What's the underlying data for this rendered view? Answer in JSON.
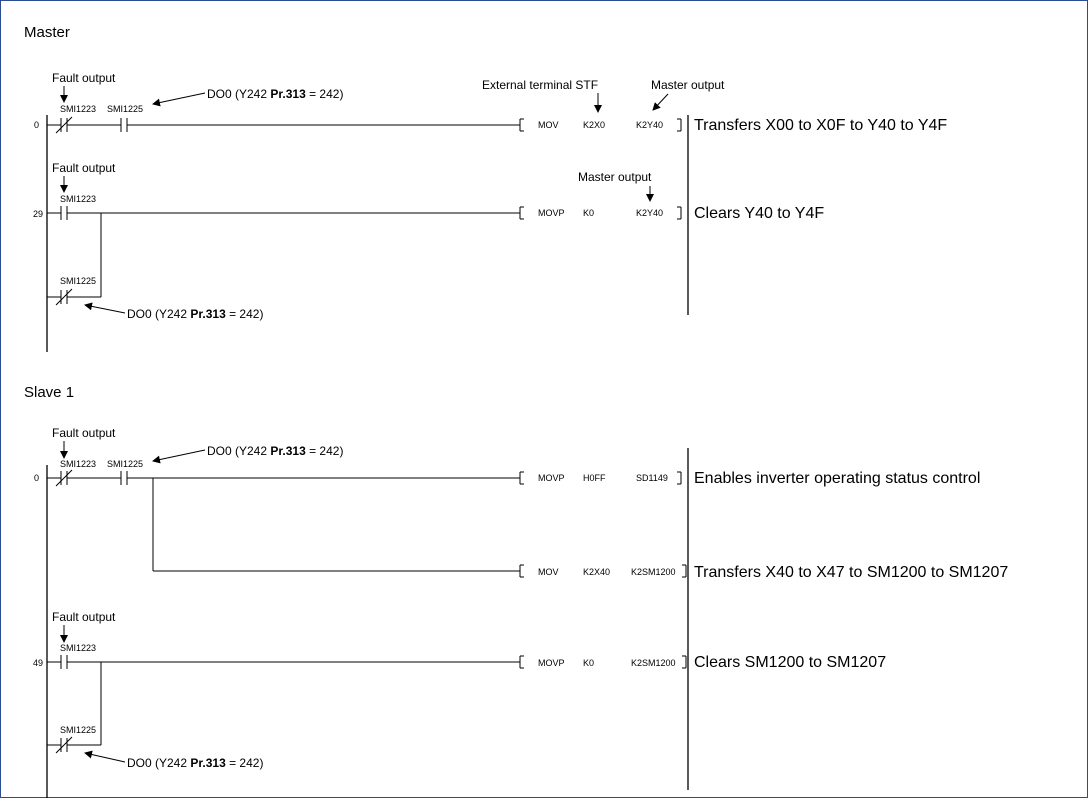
{
  "annotations": {
    "fault_output": "Fault output",
    "do0_prefix": "DO0 (Y242 ",
    "do0_pr": "Pr.313",
    "do0_suffix": " = 242)",
    "external_terminal_stf": "External terminal STF",
    "master_output": "Master output"
  },
  "sections": [
    {
      "title": "Master",
      "rungs": [
        {
          "step": "0",
          "contacts": [
            "SMI1223",
            "SMI1225"
          ],
          "instruction": "MOV",
          "source": "K2X0",
          "destination": "K2Y40",
          "comment": "Transfers X00 to X0F to Y40 to Y4F"
        },
        {
          "step": "29",
          "contacts": [
            "SMI1223",
            "SMI1225"
          ],
          "instruction": "MOVP",
          "source": "K0",
          "destination": "K2Y40",
          "comment": "Clears Y40 to Y4F"
        }
      ]
    },
    {
      "title": "Slave 1",
      "rungs": [
        {
          "step": "0",
          "contacts": [
            "SMI1223",
            "SMI1225"
          ],
          "instruction": "MOVP",
          "source": "H0FF",
          "destination": "SD1149",
          "comment": "Enables inverter operating status control"
        },
        {
          "step": "",
          "contacts": [],
          "instruction": "MOV",
          "source": "K2X40",
          "destination": "K2SM1200",
          "comment": "Transfers X40 to X47 to SM1200 to SM1207"
        },
        {
          "step": "49",
          "contacts": [
            "SMI1223",
            "SMI1225"
          ],
          "instruction": "MOVP",
          "source": "K0",
          "destination": "K2SM1200",
          "comment": "Clears SM1200 to SM1207"
        }
      ]
    }
  ]
}
